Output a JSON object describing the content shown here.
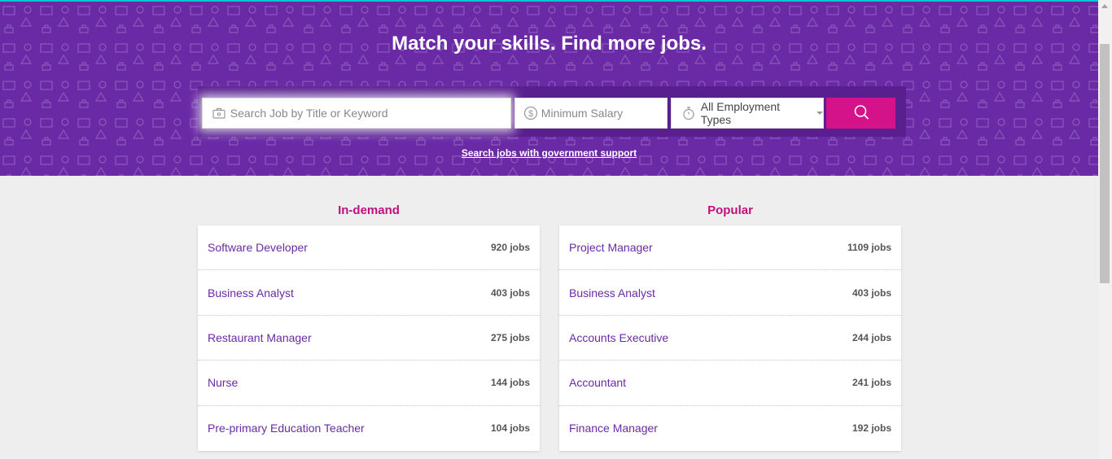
{
  "colors": {
    "hero_bg": "#6a2aa6",
    "accent": "#c0107e",
    "button": "#d4128a",
    "link": "#6a2aa6",
    "top_line": "#00c8d2"
  },
  "hero": {
    "title": "Match your skills. Find more jobs.",
    "gov_link": "Search jobs with government support"
  },
  "search": {
    "keyword_placeholder": "Search Job by Title or Keyword",
    "keyword_value": "",
    "salary_placeholder": "Minimum Salary",
    "salary_value": "",
    "employment_type": "All Employment Types",
    "keyword_icon": "briefcase-icon",
    "salary_icon": "dollar-coin-icon",
    "type_icon": "stopwatch-icon",
    "button_icon": "search-icon"
  },
  "in_demand": {
    "title": "In-demand",
    "items": [
      {
        "job": "Software Developer",
        "count": "920 jobs"
      },
      {
        "job": "Business Analyst",
        "count": "403 jobs"
      },
      {
        "job": "Restaurant Manager",
        "count": "275 jobs"
      },
      {
        "job": "Nurse",
        "count": "144 jobs"
      },
      {
        "job": "Pre-primary Education Teacher",
        "count": "104 jobs"
      }
    ]
  },
  "popular": {
    "title": "Popular",
    "items": [
      {
        "job": "Project Manager",
        "count": "1109 jobs"
      },
      {
        "job": "Business Analyst",
        "count": "403 jobs"
      },
      {
        "job": "Accounts Executive",
        "count": "244 jobs"
      },
      {
        "job": "Accountant",
        "count": "241 jobs"
      },
      {
        "job": "Finance Manager",
        "count": "192 jobs"
      }
    ]
  }
}
